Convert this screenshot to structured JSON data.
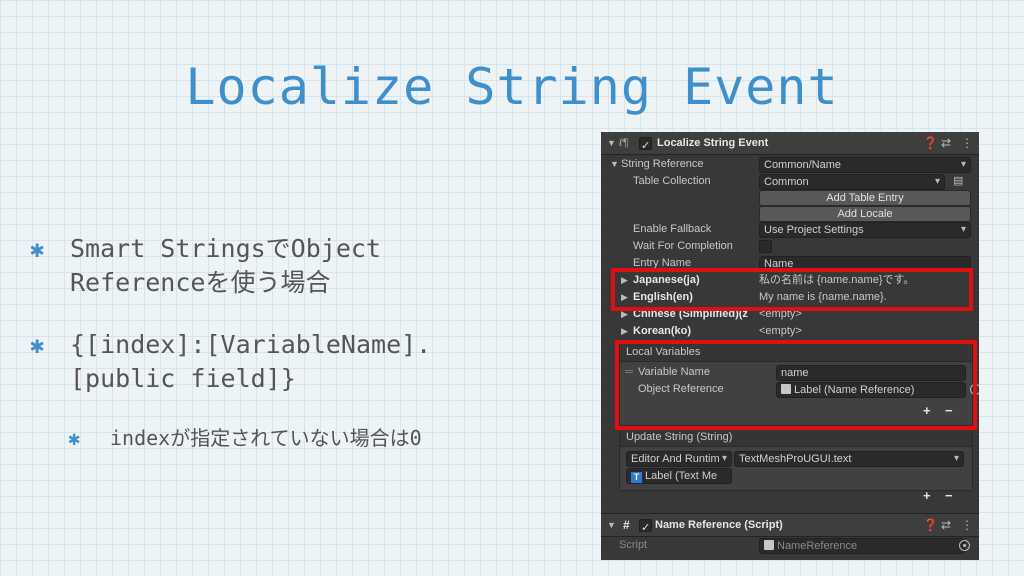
{
  "slide": {
    "title": "Localize String Event",
    "bullets": [
      {
        "line1": "Smart StringsでObject",
        "line2": "Referenceを使う場合"
      },
      {
        "line1": "{[index]:[VariableName].",
        "line2": "[public field]}"
      }
    ],
    "sub_bullet": "indexが指定されていない場合は0",
    "bullet_mark": "✱"
  },
  "inspector": {
    "component_title": "Localize String Event",
    "enabled": true,
    "string_reference_label": "String Reference",
    "string_reference_value": "Common/Name",
    "table_collection_label": "Table Collection",
    "table_collection_value": "Common",
    "add_table_entry": "Add Table Entry",
    "add_locale": "Add Locale",
    "enable_fallback_label": "Enable Fallback",
    "enable_fallback_value": "Use Project Settings",
    "wait_for_completion_label": "Wait For Completion",
    "entry_name_label": "Entry Name",
    "entry_name_value": "Name",
    "locales": [
      {
        "name": "Japanese(ja)",
        "value": "私の名前は {name.name}です。"
      },
      {
        "name": "English(en)",
        "value": "My name is {name.name}."
      },
      {
        "name": "Chinese (Simplified)(z",
        "value": "<empty>"
      },
      {
        "name": "Korean(ko)",
        "value": "<empty>"
      }
    ],
    "local_variables": {
      "header": "Local Variables",
      "variable_name_label": "Variable Name",
      "variable_name_value": "name",
      "object_reference_label": "Object Reference",
      "object_reference_value": "Label (Name Reference)"
    },
    "update_string": {
      "header": "Update String (String)",
      "runtime_value": "Editor And Runtim",
      "function_value": "TextMeshProUGUI.text",
      "target_value": "Label (Text Me"
    },
    "plus_glyph": "+",
    "minus_glyph": "−",
    "script_component": {
      "title": "Name Reference (Script)",
      "script_label": "Script",
      "script_value": "NameReference"
    },
    "colors": {
      "highlight": "#e01010",
      "accent": "#3f8fca"
    }
  }
}
